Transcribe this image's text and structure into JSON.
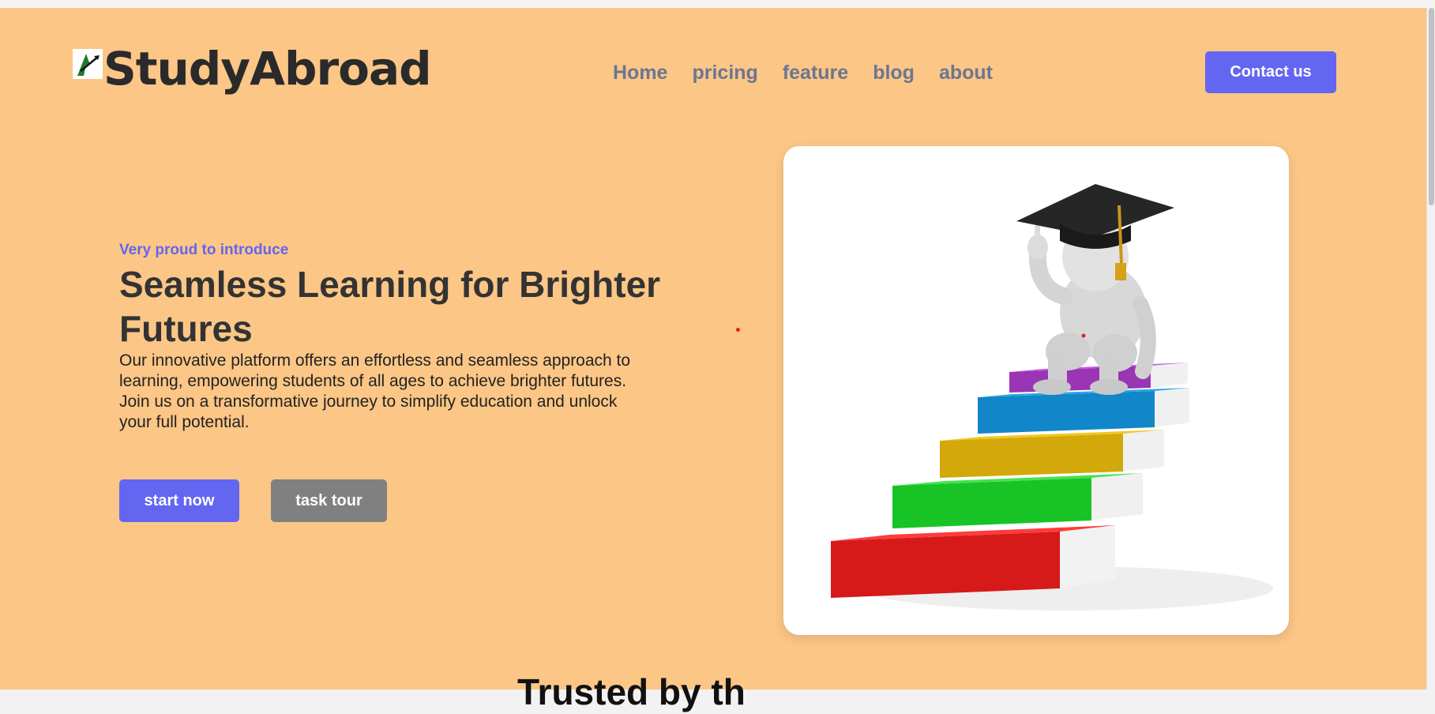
{
  "header": {
    "logo_icon": "graduation-arrow-logo",
    "brand": "StudyAbroad",
    "nav": [
      {
        "label": "Home"
      },
      {
        "label": "pricing"
      },
      {
        "label": "feature"
      },
      {
        "label": "blog"
      },
      {
        "label": "about"
      }
    ],
    "contact_label": "Contact us"
  },
  "hero": {
    "eyebrow": "Very proud to introduce",
    "title": "Seamless Learning for Brighter Futures",
    "description": "Our innovative platform offers an effortless and seamless approach to learning, empowering students of all ages to achieve brighter futures. Join us on a transformative journey to simplify education and unlock your full potential.",
    "primary_button": "start now",
    "secondary_button": "task tour",
    "image": "graduate-figure-on-book-stairs"
  },
  "next_section": {
    "heading": "Trusted by th"
  },
  "colors": {
    "page_background": "#fcc686",
    "accent": "#6366f1",
    "secondary_button": "#808080",
    "nav_text": "#6b7691",
    "heading_text": "#333333"
  }
}
